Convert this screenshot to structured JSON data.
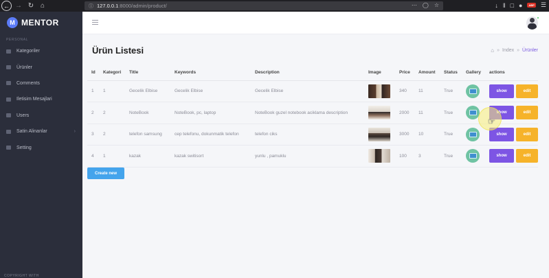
{
  "browser": {
    "url_host": "127.0.0.1",
    "url_path": ":8000/admin/product/"
  },
  "sidebar": {
    "brand": "MENTOR",
    "section": "PERSONAL",
    "items": [
      {
        "label": "Kategoriler"
      },
      {
        "label": "Ürünler"
      },
      {
        "label": "Comments"
      },
      {
        "label": "Iletisim Mesajlari"
      },
      {
        "label": "Users"
      },
      {
        "label": "Satin Alinanlar",
        "has_submenu": true
      },
      {
        "label": "Setting"
      }
    ],
    "footer": "COPYRIGHT WITH"
  },
  "page": {
    "title": "Ürün Listesi",
    "breadcrumb": {
      "index": "Index",
      "current": "Ürünler"
    }
  },
  "table": {
    "headers": [
      "Id",
      "Kategori",
      "Title",
      "Keywords",
      "Description",
      "Image",
      "Price",
      "Amount",
      "Status",
      "Gallery",
      "actions"
    ],
    "rows": [
      {
        "id": "1",
        "kategori": "1",
        "title": "Gecelik Elbise",
        "keywords": "Gecelik Elbise",
        "description": "Gecelik Elbise",
        "image": "photo-dress",
        "price": "340",
        "amount": "11",
        "status": "True"
      },
      {
        "id": "2",
        "kategori": "2",
        "title": "NoteBook",
        "keywords": "NoteBook, pc, laptop",
        "description": "NoteBook guzel notebook aciklama description",
        "image": "photo-notebook",
        "price": "2000",
        "amount": "11",
        "status": "True"
      },
      {
        "id": "3",
        "kategori": "2",
        "title": "telefon samsung",
        "keywords": "cep telefonu, dokunmatik telefon",
        "description": "telefon ciks",
        "image": "photo-phone",
        "price": "3000",
        "amount": "10",
        "status": "True"
      },
      {
        "id": "4",
        "kategori": "1",
        "title": "kazak",
        "keywords": "kazak switisort",
        "description": "yunlu , pamuklu",
        "image": "photo-sweater",
        "price": "100",
        "amount": "3",
        "status": "True"
      }
    ],
    "show_label": "show",
    "edit_label": "edit"
  },
  "create_button": "Create new",
  "colors": {
    "sidebar_bg": "#2b2e3b",
    "show_button": "#7d55e4",
    "edit_button": "#f6b32a",
    "create_button": "#44a4ec",
    "breadcrumb_active": "#7a5ae0"
  }
}
